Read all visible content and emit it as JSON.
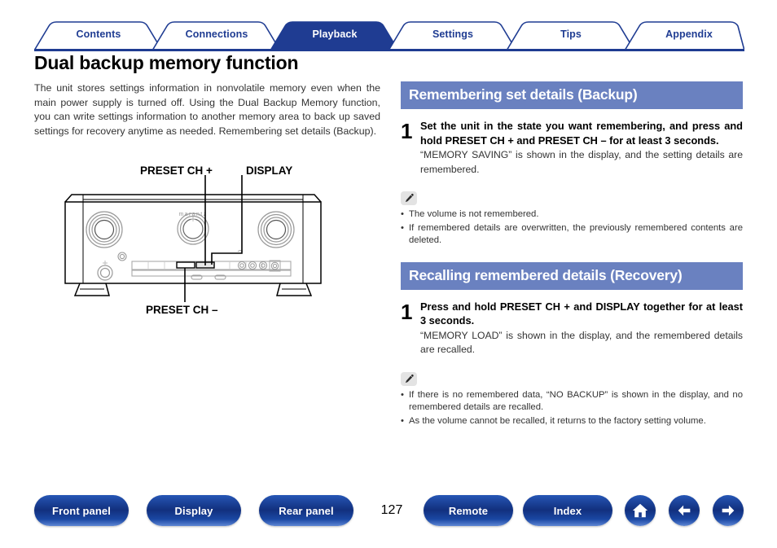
{
  "tabs": [
    {
      "label": "Contents",
      "active": false
    },
    {
      "label": "Connections",
      "active": false
    },
    {
      "label": "Playback",
      "active": true
    },
    {
      "label": "Settings",
      "active": false
    },
    {
      "label": "Tips",
      "active": false
    },
    {
      "label": "Appendix",
      "active": false
    }
  ],
  "page": {
    "title": "Dual backup memory function",
    "number": "127"
  },
  "intro": {
    "paragraph": "The unit stores settings information in nonvolatile memory even when the main power supply is turned off. Using the Dual Backup Memory function, you can write settings information to another memory area to back up saved settings for recovery anytime as needed. Remembering set details (Backup)."
  },
  "figure": {
    "brand": "marantz",
    "callout_preset_plus": "PRESET CH +",
    "callout_display": "DISPLAY",
    "callout_preset_minus": "PRESET CH –"
  },
  "sections": [
    {
      "header": "Remembering set details (Backup)",
      "step_number": "1",
      "step_title": "Set the unit in the state you want remembering, and press and hold PRESET CH + and PRESET CH – for at least 3 seconds.",
      "step_desc": "“MEMORY SAVING” is shown in the display, and the setting details are remembered.",
      "note_icon": "pencil-icon",
      "notes": [
        "The volume is not remembered.",
        "If remembered details are overwritten, the previously remembered contents are deleted."
      ]
    },
    {
      "header": "Recalling remembered details (Recovery)",
      "step_number": "1",
      "step_title": "Press and hold PRESET CH + and DISPLAY together for at least 3 seconds.",
      "step_desc": "“MEMORY LOAD” is shown in the display, and the remembered details are recalled.",
      "note_icon": "pencil-icon",
      "notes": [
        "If there is no remembered data, “NO BACKUP” is shown in the display, and no remembered details are recalled.",
        "As the volume cannot be recalled, it returns to the factory setting volume."
      ]
    }
  ],
  "bottom_nav": {
    "front_panel": "Front panel",
    "display": "Display",
    "rear_panel": "Rear panel",
    "remote": "Remote",
    "index": "Index",
    "home_icon": "home-icon",
    "back_icon": "arrow-left-icon",
    "forward_icon": "arrow-right-icon"
  },
  "colors": {
    "tab_active": "#1f3c92",
    "tab_text": "#1f3c92",
    "section_header_bg": "#6a81c0",
    "button_blue": "#12307e"
  }
}
